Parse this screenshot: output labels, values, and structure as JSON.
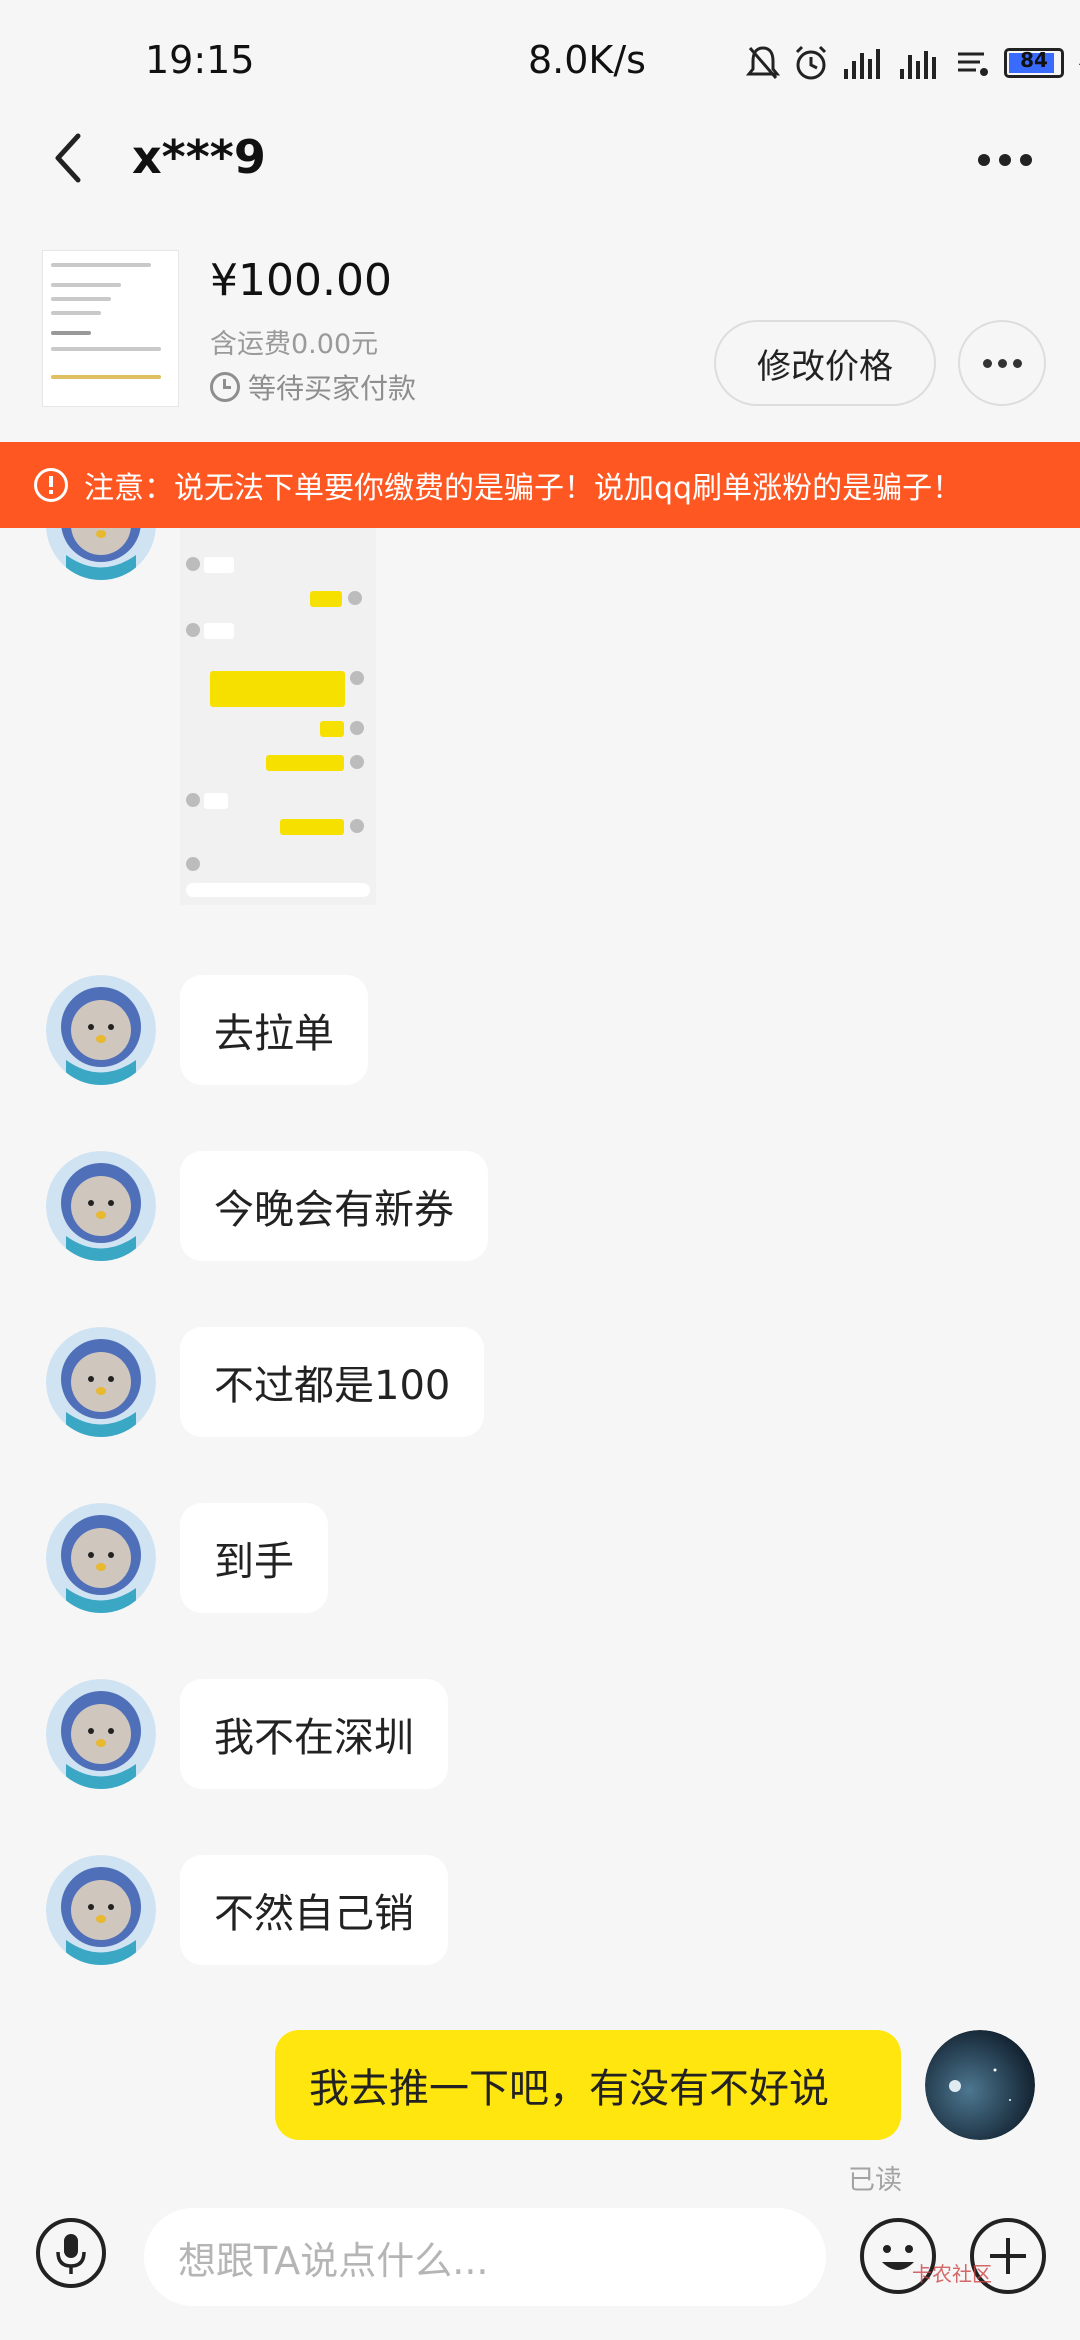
{
  "status_bar": {
    "time": "19:15",
    "net_speed": "8.0K/s",
    "battery": "84"
  },
  "header": {
    "title": "x***9"
  },
  "product": {
    "price": "¥100.00",
    "shipping": "含运费0.00元",
    "status": "等待买家付款",
    "modify_price_label": "修改价格"
  },
  "warning": {
    "text": "注意：说无法下单要你缴费的是骗子！说加qq刷单涨粉的是骗子！"
  },
  "messages": [
    {
      "text": "去拉单"
    },
    {
      "text": "今晚会有新券"
    },
    {
      "text": "不过都是100"
    },
    {
      "text": "到手"
    },
    {
      "text": "我不在深圳"
    },
    {
      "text": "不然自己销"
    }
  ],
  "my_message": {
    "text": "我去推一下吧，有没有不好说",
    "read_status": "已读"
  },
  "input": {
    "placeholder": "想跟TA说点什么..."
  },
  "watermark": {
    "text": "卡农社区"
  },
  "colors": {
    "warning_bg": "#ff5722",
    "my_bubble": "#ffe60f",
    "background": "#f6f6f6"
  }
}
